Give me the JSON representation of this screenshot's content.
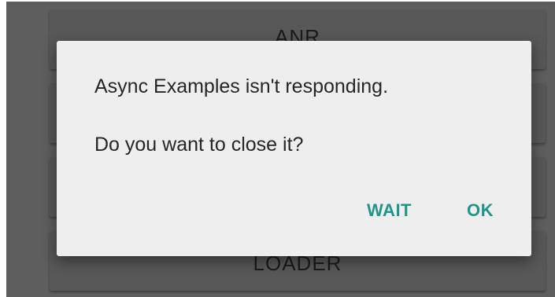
{
  "background_buttons": [
    {
      "label": "ANR"
    },
    {
      "label": ""
    },
    {
      "label": ""
    },
    {
      "label": "LOADER"
    }
  ],
  "dialog": {
    "message": "Async Examples isn't responding.",
    "question": "Do you want to close it?",
    "wait_label": "WAIT",
    "ok_label": "OK"
  },
  "colors": {
    "accent": "#1e9688",
    "dialog_bg": "#eeeeee",
    "scrim": "#5e5e5e"
  }
}
